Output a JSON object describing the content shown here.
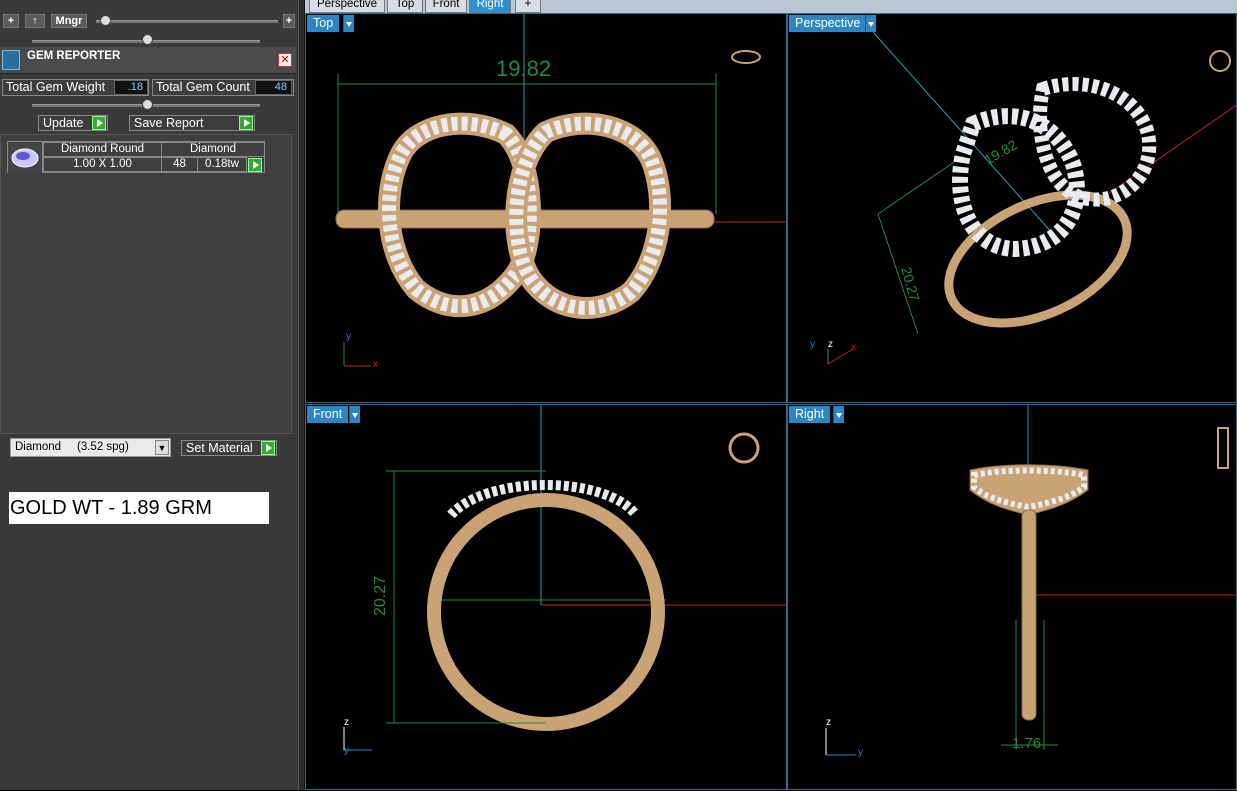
{
  "toolbar": {
    "mngr_label": "Mngr",
    "add_label": "+",
    "up_label": "↑"
  },
  "gem_reporter": {
    "title": "GEM REPORTER",
    "total_weight_label": "Total Gem Weight",
    "total_weight_value": ".18",
    "total_count_label": "Total Gem Count",
    "total_count_value": "48",
    "update_label": "Update",
    "save_report_label": "Save Report",
    "table": {
      "shape_header": "Diamond Round",
      "material_header": "Diamond",
      "size": "1.00 X 1.00",
      "count": "48",
      "weight": "0.18tw"
    }
  },
  "material": {
    "selected": "Diamond     (3.52 spg)",
    "set_label": "Set Material"
  },
  "gold_weight": "GOLD WT - 1.89 GRM",
  "tabs": [
    {
      "label": "Perspective"
    },
    {
      "label": "Top"
    },
    {
      "label": "Front"
    },
    {
      "label": "Right"
    },
    {
      "label": "+"
    }
  ],
  "viewports": {
    "top": {
      "label": "Top",
      "dimension": "19.82"
    },
    "perspective": {
      "label": "Perspective",
      "dimension_a": "19.82",
      "dimension_b": "20.27"
    },
    "front": {
      "label": "Front",
      "dimension": "20.27"
    },
    "right": {
      "label": "Right",
      "dimension": "1.76"
    }
  },
  "axes": {
    "x": "x",
    "y": "y",
    "z": "z"
  },
  "colors": {
    "gold": "#c9a374",
    "diamond": "#e8ecef",
    "dim": "#1f8a3e",
    "axis_blue": "#1fa0b8",
    "axis_red": "#c0202a",
    "viewport_label": "#2b86c6"
  }
}
